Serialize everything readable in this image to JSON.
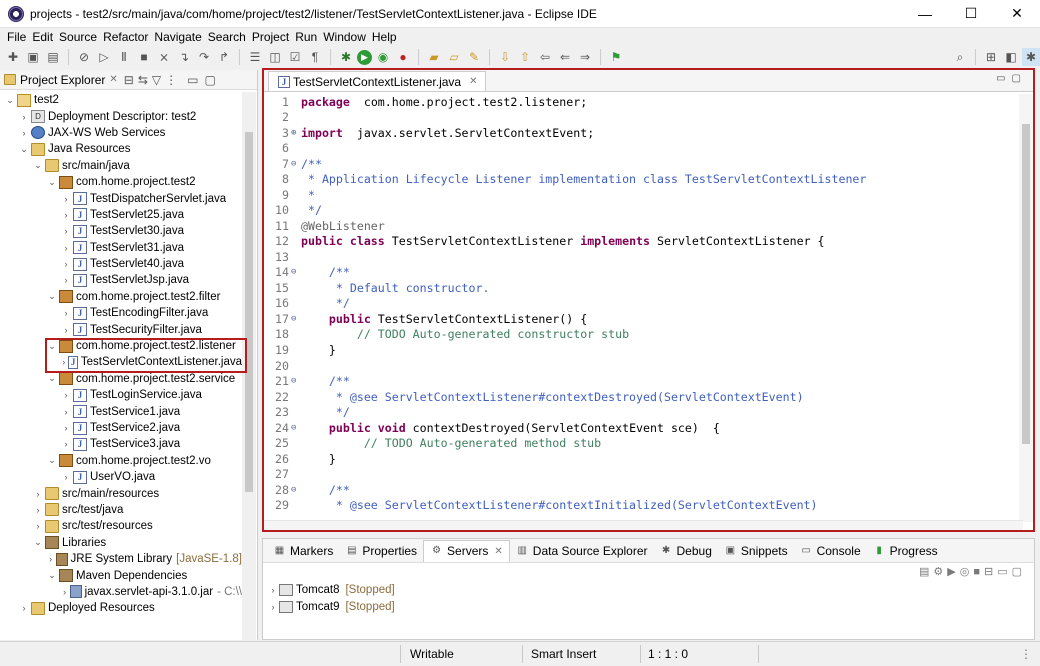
{
  "window": {
    "title": "projects - test2/src/main/java/com/home/project/test2/listener/TestServletContextListener.java - Eclipse IDE",
    "minimize": "—",
    "maximize": "☐",
    "close": "✕"
  },
  "menu": [
    "File",
    "Edit",
    "Source",
    "Refactor",
    "Navigate",
    "Search",
    "Project",
    "Run",
    "Window",
    "Help"
  ],
  "explorer": {
    "title": "Project Explorer",
    "tree": [
      {
        "label": "test2",
        "level": 0,
        "twisty": "open",
        "icon": "project"
      },
      {
        "label": "Deployment Descriptor: test2",
        "level": 1,
        "twisty": "closed",
        "icon": "dd"
      },
      {
        "label": "JAX-WS Web Services",
        "level": 1,
        "twisty": "closed",
        "icon": "web"
      },
      {
        "label": "Java Resources",
        "level": 1,
        "twisty": "open",
        "icon": "folder"
      },
      {
        "label": "src/main/java",
        "level": 2,
        "twisty": "open",
        "icon": "folder"
      },
      {
        "label": "com.home.project.test2",
        "level": 3,
        "twisty": "open",
        "icon": "pkg"
      },
      {
        "label": "TestDispatcherServlet.java",
        "level": 4,
        "twisty": "closed",
        "icon": "java"
      },
      {
        "label": "TestServlet25.java",
        "level": 4,
        "twisty": "closed",
        "icon": "java"
      },
      {
        "label": "TestServlet30.java",
        "level": 4,
        "twisty": "closed",
        "icon": "java"
      },
      {
        "label": "TestServlet31.java",
        "level": 4,
        "twisty": "closed",
        "icon": "java"
      },
      {
        "label": "TestServlet40.java",
        "level": 4,
        "twisty": "closed",
        "icon": "java"
      },
      {
        "label": "TestServletJsp.java",
        "level": 4,
        "twisty": "closed",
        "icon": "java"
      },
      {
        "label": "com.home.project.test2.filter",
        "level": 3,
        "twisty": "open",
        "icon": "pkg"
      },
      {
        "label": "TestEncodingFilter.java",
        "level": 4,
        "twisty": "closed",
        "icon": "java"
      },
      {
        "label": "TestSecurityFilter.java",
        "level": 4,
        "twisty": "closed",
        "icon": "java"
      },
      {
        "label": "com.home.project.test2.listener",
        "level": 3,
        "twisty": "open",
        "icon": "pkg"
      },
      {
        "label": "TestServletContextListener.java",
        "level": 4,
        "twisty": "closed",
        "icon": "java"
      },
      {
        "label": "com.home.project.test2.service",
        "level": 3,
        "twisty": "open",
        "icon": "pkg"
      },
      {
        "label": "TestLoginService.java",
        "level": 4,
        "twisty": "closed",
        "icon": "java"
      },
      {
        "label": "TestService1.java",
        "level": 4,
        "twisty": "closed",
        "icon": "java"
      },
      {
        "label": "TestService2.java",
        "level": 4,
        "twisty": "closed",
        "icon": "java"
      },
      {
        "label": "TestService3.java",
        "level": 4,
        "twisty": "closed",
        "icon": "java"
      },
      {
        "label": "com.home.project.test2.vo",
        "level": 3,
        "twisty": "open",
        "icon": "pkg"
      },
      {
        "label": "UserVO.java",
        "level": 4,
        "twisty": "closed",
        "icon": "java"
      },
      {
        "label": "src/main/resources",
        "level": 2,
        "twisty": "closed",
        "icon": "folder"
      },
      {
        "label": "src/test/java",
        "level": 2,
        "twisty": "closed",
        "icon": "folder"
      },
      {
        "label": "src/test/resources",
        "level": 2,
        "twisty": "closed",
        "icon": "folder"
      },
      {
        "label": "Libraries",
        "level": 2,
        "twisty": "open",
        "icon": "lib"
      },
      {
        "label": "JRE System Library",
        "suffix": "[JavaSE-1.8]",
        "level": 3,
        "twisty": "closed",
        "icon": "lib"
      },
      {
        "label": "Maven Dependencies",
        "level": 3,
        "twisty": "open",
        "icon": "lib"
      },
      {
        "label": "javax.servlet-api-3.1.0.jar",
        "suffix": "- C:\\\\",
        "level": 4,
        "twisty": "closed",
        "icon": "jar"
      },
      {
        "label": "Deployed Resources",
        "level": 1,
        "twisty": "closed",
        "icon": "folder"
      }
    ]
  },
  "editor": {
    "tab": "TestServletContextListener.java",
    "lines": [
      {
        "n": "1",
        "fold": "",
        "segs": [
          [
            "kw",
            "package"
          ],
          [
            "",
            "  com.home.project.test2.listener;"
          ]
        ]
      },
      {
        "n": "2",
        "fold": "",
        "segs": []
      },
      {
        "n": "3",
        "fold": "⊕",
        "segs": [
          [
            "kw",
            "import"
          ],
          [
            "",
            "  javax.servlet.ServletContextEvent;"
          ]
        ]
      },
      {
        "n": "6",
        "fold": "",
        "segs": []
      },
      {
        "n": "7",
        "fold": "⊖",
        "segs": [
          [
            "jd",
            "/**"
          ]
        ]
      },
      {
        "n": "8",
        "fold": "",
        "segs": [
          [
            "jd",
            " * Application Lifecycle Listener implementation class TestServletContextListener"
          ]
        ]
      },
      {
        "n": "9",
        "fold": "",
        "segs": [
          [
            "jd",
            " *"
          ]
        ]
      },
      {
        "n": "10",
        "fold": "",
        "segs": [
          [
            "jd",
            " */"
          ]
        ]
      },
      {
        "n": "11",
        "fold": "",
        "segs": [
          [
            "ann",
            "@WebListener"
          ]
        ]
      },
      {
        "n": "12",
        "fold": "",
        "segs": [
          [
            "kw",
            "public class"
          ],
          [
            "",
            " TestServletContextListener "
          ],
          [
            "kw",
            "implements"
          ],
          [
            "",
            " ServletContextListener {"
          ]
        ]
      },
      {
        "n": "13",
        "fold": "",
        "segs": []
      },
      {
        "n": "14",
        "fold": "⊖",
        "segs": [
          [
            "jd",
            "    /**"
          ]
        ]
      },
      {
        "n": "15",
        "fold": "",
        "segs": [
          [
            "jd",
            "     * Default constructor."
          ]
        ]
      },
      {
        "n": "16",
        "fold": "",
        "segs": [
          [
            "jd",
            "     */"
          ]
        ]
      },
      {
        "n": "17",
        "fold": "⊖",
        "segs": [
          [
            "kw",
            "    public"
          ],
          [
            "",
            " TestServletContextListener() {"
          ]
        ]
      },
      {
        "n": "18",
        "fold": "",
        "segs": [
          [
            "cm",
            "        // TODO Auto-generated constructor stub"
          ]
        ]
      },
      {
        "n": "19",
        "fold": "",
        "segs": [
          [
            "",
            "    }"
          ]
        ]
      },
      {
        "n": "20",
        "fold": "",
        "segs": []
      },
      {
        "n": "21",
        "fold": "⊖",
        "segs": [
          [
            "jd",
            "    /**"
          ]
        ]
      },
      {
        "n": "22",
        "fold": "",
        "segs": [
          [
            "jd",
            "     * @see ServletContextListener#contextDestroyed(ServletContextEvent)"
          ]
        ]
      },
      {
        "n": "23",
        "fold": "",
        "segs": [
          [
            "jd",
            "     */"
          ]
        ]
      },
      {
        "n": "24",
        "fold": "⊖",
        "segs": [
          [
            "kw",
            "    public void"
          ],
          [
            "",
            " contextDestroyed(ServletContextEvent sce)  {"
          ]
        ]
      },
      {
        "n": "25",
        "fold": "",
        "segs": [
          [
            "cm",
            "         // TODO Auto-generated method stub"
          ]
        ]
      },
      {
        "n": "26",
        "fold": "",
        "segs": [
          [
            "",
            "    }"
          ]
        ]
      },
      {
        "n": "27",
        "fold": "",
        "segs": []
      },
      {
        "n": "28",
        "fold": "⊖",
        "segs": [
          [
            "jd",
            "    /**"
          ]
        ]
      },
      {
        "n": "29",
        "fold": "",
        "segs": [
          [
            "jd",
            "     * @see ServletContextListener#contextInitialized(ServletContextEvent)"
          ]
        ]
      }
    ]
  },
  "bottom_panel": {
    "tabs": [
      "Markers",
      "Properties",
      "Servers",
      "Data Source Explorer",
      "Debug",
      "Snippets",
      "Console",
      "Progress"
    ],
    "active_tab": "Servers",
    "servers": [
      {
        "name": "Tomcat8",
        "status": "[Stopped]"
      },
      {
        "name": "Tomcat9",
        "status": "[Stopped]"
      }
    ]
  },
  "statusbar": {
    "mode": "Writable",
    "insert": "Smart Insert",
    "position": "1 : 1 : 0"
  },
  "colors": {
    "highlight_border": "#b71c1c",
    "keyword": "#7f0055",
    "comment": "#3f7f5f",
    "javadoc": "#3f5fbf"
  }
}
